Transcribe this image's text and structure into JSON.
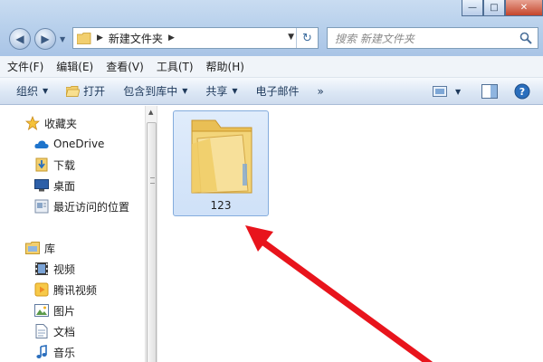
{
  "window": {
    "minimize_label": "—",
    "maximize_label": "□",
    "close_label": "✕"
  },
  "address_bar": {
    "current_folder": "新建文件夹"
  },
  "search": {
    "placeholder": "搜索 新建文件夹"
  },
  "menu": {
    "items": [
      {
        "label": "文件(F)"
      },
      {
        "label": "编辑(E)"
      },
      {
        "label": "查看(V)"
      },
      {
        "label": "工具(T)"
      },
      {
        "label": "帮助(H)"
      }
    ]
  },
  "toolbar": {
    "organize": "组织",
    "open": "打开",
    "include_in_library": "包含到库中",
    "share": "共享",
    "email": "电子邮件",
    "more": "»"
  },
  "navigation": {
    "favorites": "收藏夹",
    "onedrive": "OneDrive",
    "downloads": "下载",
    "desktop": "桌面",
    "recent": "最近访问的位置",
    "libraries": "库",
    "videos": "视频",
    "tencent_video": "腾讯视频",
    "pictures": "图片",
    "documents": "文档",
    "music": "音乐"
  },
  "content": {
    "items": [
      {
        "name": "123",
        "type": "folder",
        "selected": true
      }
    ]
  },
  "colors": {
    "selection_fill": "#cfe1f8",
    "selection_border": "#84acdd",
    "annotation_arrow": "#e8141c",
    "folder_yellow": "#f3d57a"
  }
}
